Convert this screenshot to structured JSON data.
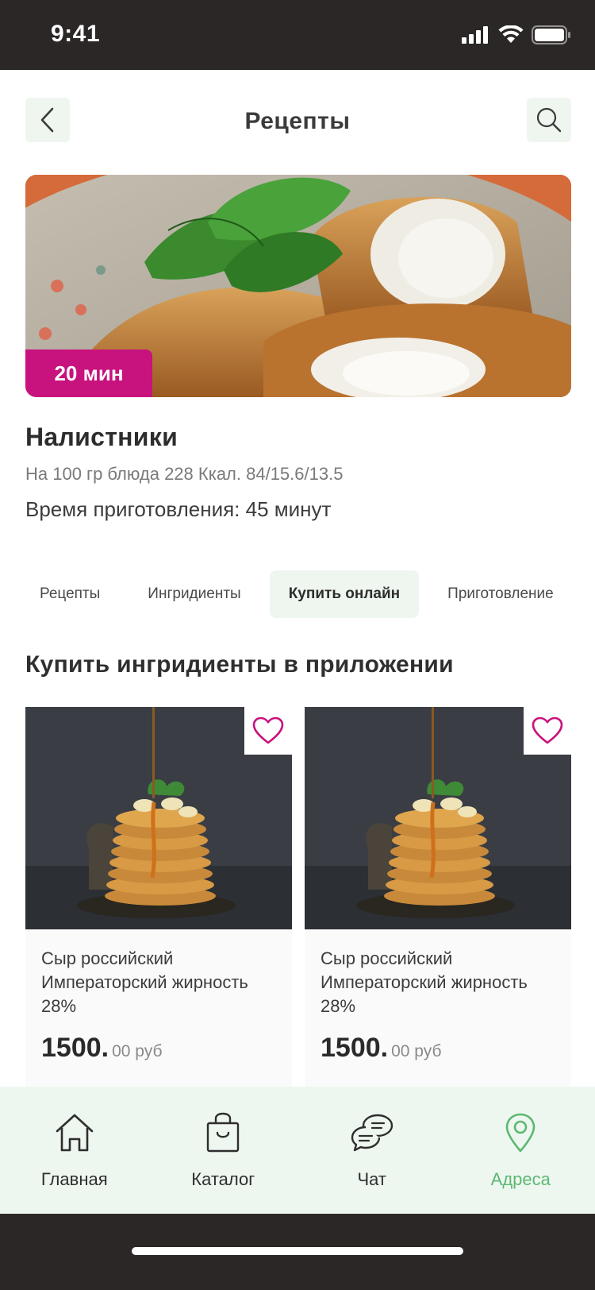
{
  "status_bar": {
    "time": "9:41"
  },
  "header": {
    "title": "Рецепты"
  },
  "hero": {
    "time_badge": "20 мин"
  },
  "recipe": {
    "name": "Налистники",
    "nutrition": "На 100 гр блюда 228 Ккал. 84/15.6/13.5",
    "cook_time": "Время приготовления: 45 минут"
  },
  "tabs": [
    {
      "label": "Рецепты",
      "active": false
    },
    {
      "label": "Ингридиенты",
      "active": false
    },
    {
      "label": "Купить онлайн",
      "active": true
    },
    {
      "label": "Приготовление",
      "active": false
    }
  ],
  "section": {
    "title": "Купить ингридиенты в приложении"
  },
  "products": [
    {
      "title": "Сыр российский Императорский жирность 28%",
      "price_main": "1500.",
      "price_sub": "00 руб"
    },
    {
      "title": "Сыр российский Императорский жирность 28%",
      "price_main": "1500.",
      "price_sub": "00 руб"
    }
  ],
  "bottom_nav": [
    {
      "label": "Главная",
      "icon": "home-icon",
      "active": false
    },
    {
      "label": "Каталог",
      "icon": "bag-icon",
      "active": false
    },
    {
      "label": "Чат",
      "icon": "chat-icon",
      "active": false
    },
    {
      "label": "Адреса",
      "icon": "location-pin-icon",
      "active": true
    }
  ],
  "colors": {
    "accent": "#c8127e",
    "brand_green": "#5cb872",
    "light_green": "#eef6ef",
    "dark_bar": "#2c2727"
  }
}
